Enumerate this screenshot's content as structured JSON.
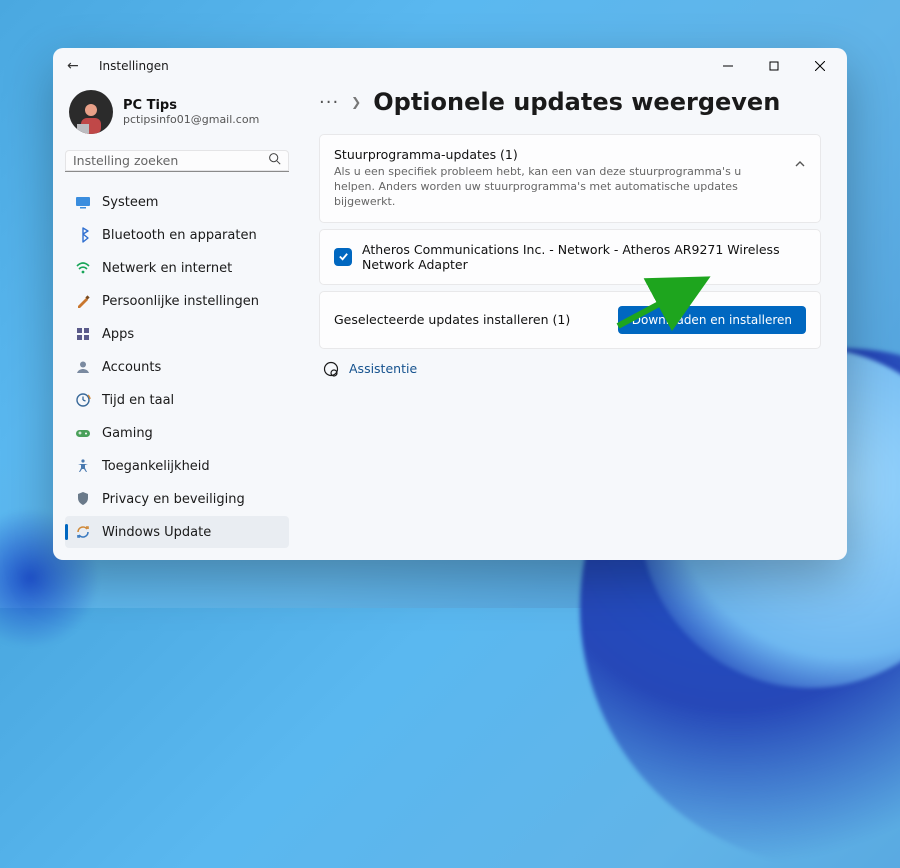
{
  "window": {
    "title": "Instellingen"
  },
  "account": {
    "name": "PC Tips",
    "email": "pctipsinfo01@gmail.com"
  },
  "search": {
    "placeholder": "Instelling zoeken"
  },
  "sidebar": {
    "items": [
      {
        "label": "Systeem",
        "icon": "system"
      },
      {
        "label": "Bluetooth en apparaten",
        "icon": "bluetooth"
      },
      {
        "label": "Netwerk en internet",
        "icon": "network"
      },
      {
        "label": "Persoonlijke instellingen",
        "icon": "personalize"
      },
      {
        "label": "Apps",
        "icon": "apps"
      },
      {
        "label": "Accounts",
        "icon": "accounts"
      },
      {
        "label": "Tijd en taal",
        "icon": "time"
      },
      {
        "label": "Gaming",
        "icon": "gaming"
      },
      {
        "label": "Toegankelijkheid",
        "icon": "accessibility"
      },
      {
        "label": "Privacy en beveiliging",
        "icon": "privacy"
      },
      {
        "label": "Windows Update",
        "icon": "update",
        "active": true
      }
    ]
  },
  "main": {
    "breadcrumb_more": "···",
    "page_title": "Optionele updates weergeven",
    "expander": {
      "title": "Stuurprogramma-updates (1)",
      "desc": "Als u een specifiek probleem hebt, kan een van deze stuurprogramma's u helpen. Anders worden uw stuurprogramma's met automatische updates bijgewerkt."
    },
    "driver": {
      "checked": true,
      "name": "Atheros Communications Inc. - Network - Atheros AR9271 Wireless Network Adapter"
    },
    "install": {
      "label": "Geselecteerde updates installeren (1)",
      "button": "Downloaden en installeren"
    },
    "help_link": "Assistentie"
  }
}
